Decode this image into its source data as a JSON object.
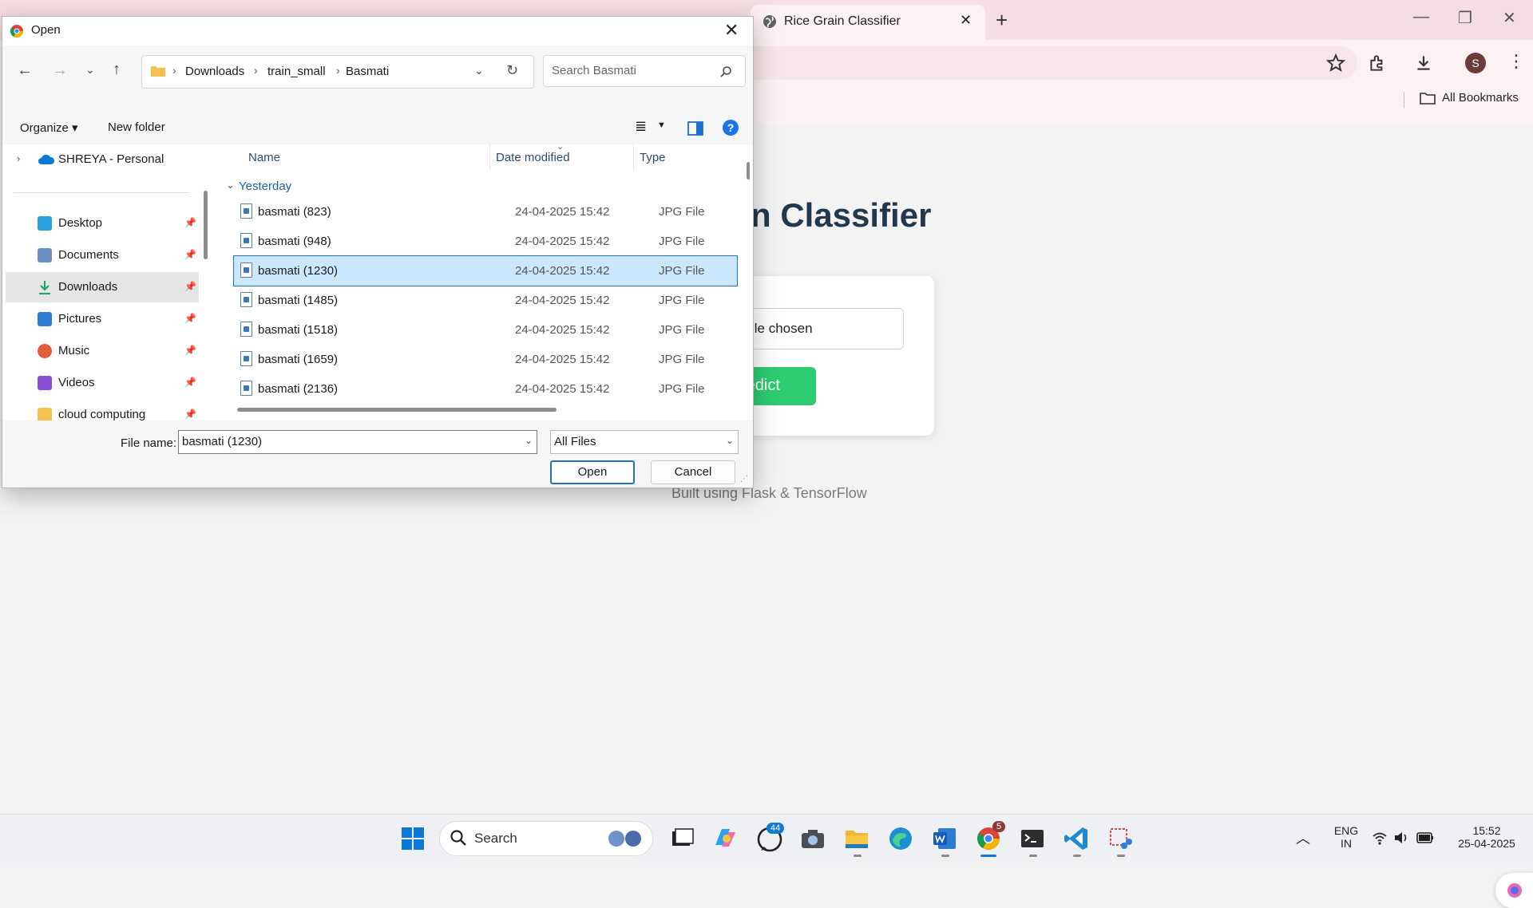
{
  "browser": {
    "tab_title": "Rice Grain Classifier",
    "bookmarks_label": "All Bookmarks",
    "profile_initial": "S"
  },
  "page": {
    "heading": "n Classifier",
    "file_status": "ile chosen",
    "predict_label": "redict",
    "footer": "Built using Flask & TensorFlow"
  },
  "dialog": {
    "title": "Open",
    "breadcrumb": [
      "Downloads",
      "train_small",
      "Basmati"
    ],
    "search_placeholder": "Search Basmati",
    "organize_label": "Organize ▾",
    "new_folder_label": "New folder",
    "nav": {
      "onedrive": "SHREYA - Personal",
      "items": [
        {
          "label": "Desktop",
          "icon": "desktop-icon",
          "color": "#2b9fe0"
        },
        {
          "label": "Documents",
          "icon": "documents-icon",
          "color": "#6c8ebf"
        },
        {
          "label": "Downloads",
          "icon": "downloads-icon",
          "color": "#1aa36b"
        },
        {
          "label": "Pictures",
          "icon": "pictures-icon",
          "color": "#2f7fd6"
        },
        {
          "label": "Music",
          "icon": "music-icon",
          "color": "#e0603a"
        },
        {
          "label": "Videos",
          "icon": "videos-icon",
          "color": "#8a4fd8"
        },
        {
          "label": "cloud computing",
          "icon": "folder-icon",
          "color": "#f2c14e"
        }
      ]
    },
    "columns": {
      "name": "Name",
      "date": "Date modified",
      "type": "Type"
    },
    "group": "Yesterday",
    "files": [
      {
        "name": "basmati (823)",
        "date": "24-04-2025 15:42",
        "type": "JPG File"
      },
      {
        "name": "basmati (948)",
        "date": "24-04-2025 15:42",
        "type": "JPG File"
      },
      {
        "name": "basmati (1230)",
        "date": "24-04-2025 15:42",
        "type": "JPG File"
      },
      {
        "name": "basmati (1485)",
        "date": "24-04-2025 15:42",
        "type": "JPG File"
      },
      {
        "name": "basmati (1518)",
        "date": "24-04-2025 15:42",
        "type": "JPG File"
      },
      {
        "name": "basmati (1659)",
        "date": "24-04-2025 15:42",
        "type": "JPG File"
      },
      {
        "name": "basmati (2136)",
        "date": "24-04-2025 15:42",
        "type": "JPG File"
      }
    ],
    "selected_file": "basmati (1230)",
    "file_name_label": "File name:",
    "file_name_value": "basmati (1230)",
    "file_type_value": "All Files",
    "open_label": "Open",
    "cancel_label": "Cancel"
  },
  "taskbar": {
    "search_label": "Search",
    "whatsapp_badge": "44",
    "chrome_badge": "5",
    "lang_line1": "ENG",
    "lang_line2": "IN",
    "time": "15:52",
    "date": "25-04-2025"
  },
  "colors": {
    "accent": "#1e70cc",
    "predict": "#2ecc71",
    "heading": "#22384f"
  }
}
